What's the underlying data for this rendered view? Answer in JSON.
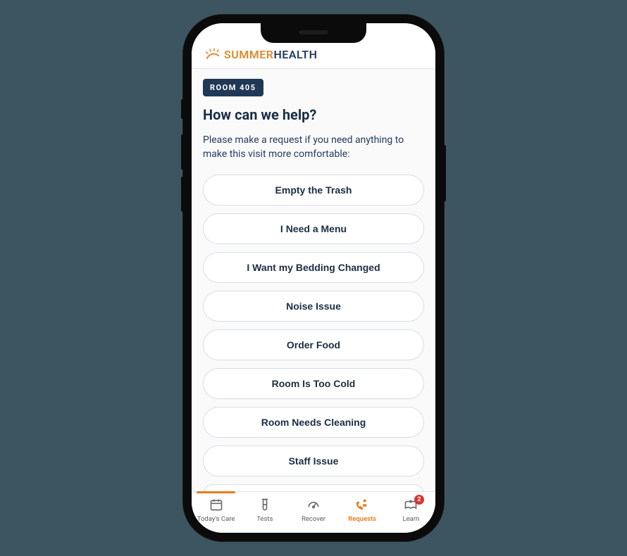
{
  "brand": {
    "word1": "SUMMER",
    "word2": "HEALTH"
  },
  "room_badge": "ROOM 405",
  "heading": "How can we help?",
  "subtext": "Please make a request if you need anything to make this visit more comfortable:",
  "requests": [
    "Empty the Trash",
    "I Need a Menu",
    "I Want my Bedding Changed",
    "Noise Issue",
    "Order Food",
    "Room Is Too Cold",
    "Room Needs Cleaning",
    "Staff Issue"
  ],
  "nav": {
    "items": [
      {
        "label": "Today's Care",
        "icon": "calendar-icon",
        "active": false
      },
      {
        "label": "Tests",
        "icon": "vial-icon",
        "active": false
      },
      {
        "label": "Recover",
        "icon": "gauge-icon",
        "active": false
      },
      {
        "label": "Requests",
        "icon": "call-person-icon",
        "active": true
      },
      {
        "label": "Learn",
        "icon": "book-person-icon",
        "active": false,
        "badge": "2"
      }
    ]
  },
  "colors": {
    "accent_orange": "#e87b1e",
    "brand_navy": "#1e3a5f",
    "badge_bg": "#1e3856",
    "notif_red": "#d9362f"
  }
}
